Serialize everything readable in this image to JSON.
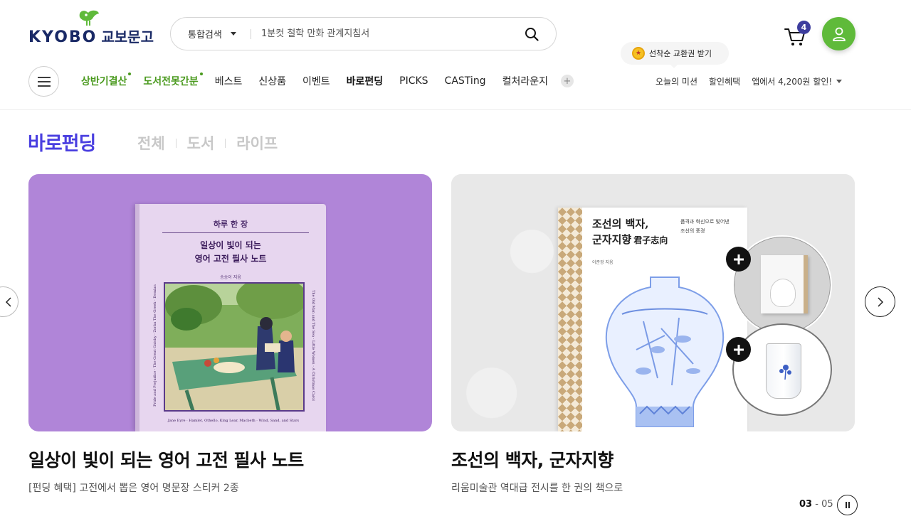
{
  "header": {
    "logo_en": "KYOBO",
    "logo_ko": "교보문고",
    "search": {
      "category": "통합검색",
      "placeholder": "1분컷 철학 만화 관계지침서"
    },
    "cart_count": "4",
    "tooltip": "선착순 교환권 받기"
  },
  "nav": {
    "items": [
      {
        "label": "상반기결산",
        "style": "green",
        "dot": true
      },
      {
        "label": "도서전못간분",
        "style": "green",
        "dot": true
      },
      {
        "label": "베스트"
      },
      {
        "label": "신상품"
      },
      {
        "label": "이벤트"
      },
      {
        "label": "바로펀딩",
        "style": "bold"
      },
      {
        "label": "PICKS"
      },
      {
        "label": "CASTing"
      },
      {
        "label": "컬처라운지"
      }
    ],
    "more": "+",
    "util": [
      "오늘의 미션",
      "할인혜택",
      "앱에서 4,200원 할인!"
    ]
  },
  "section": {
    "title": "바로펀딩",
    "tabs": [
      "전체",
      "도서",
      "라이프"
    ]
  },
  "cards": [
    {
      "title": "일상이 빛이 되는 영어 고전 필사 노트",
      "desc": "[펀딩 혜택] 고전에서 뽑은 영어 명문장 스티커 2종",
      "book": {
        "top": "하루 한 장",
        "line1": "일상이 빛이 되는",
        "line2": "영어 고전 필사 노트",
        "author": "송송이 지음",
        "footer": "Jane Eyre · Hamlet, Othello, King Lear, Macbeth · Wind, Sand, and Stars",
        "side_left": "Pride and Prejudice · The Great Gatsby · Zorba The Greek · Demian",
        "side_right": "The Old Man and The Sea · Little Women · A Christmas Carol"
      }
    },
    {
      "title": "조선의 백자, 군자지향",
      "desc": "리움미술관 역대급 전시를 한 권의 책으로",
      "book": {
        "line1": "조선의 백자,",
        "line2": "군자지향",
        "hanja": "君子志向",
        "sub1": "품격과 혁신으로 빛어낸",
        "sub2": "조선의 풍경",
        "author": "이준광 지음"
      }
    }
  ],
  "pager": {
    "current": "03",
    "sep": " - ",
    "total": "05"
  },
  "colors": {
    "brand_navy": "#1a2a66",
    "brand_green": "#5fba3a",
    "funding_purple": "#4a3fe0",
    "card1_bg": "#b085d8"
  }
}
